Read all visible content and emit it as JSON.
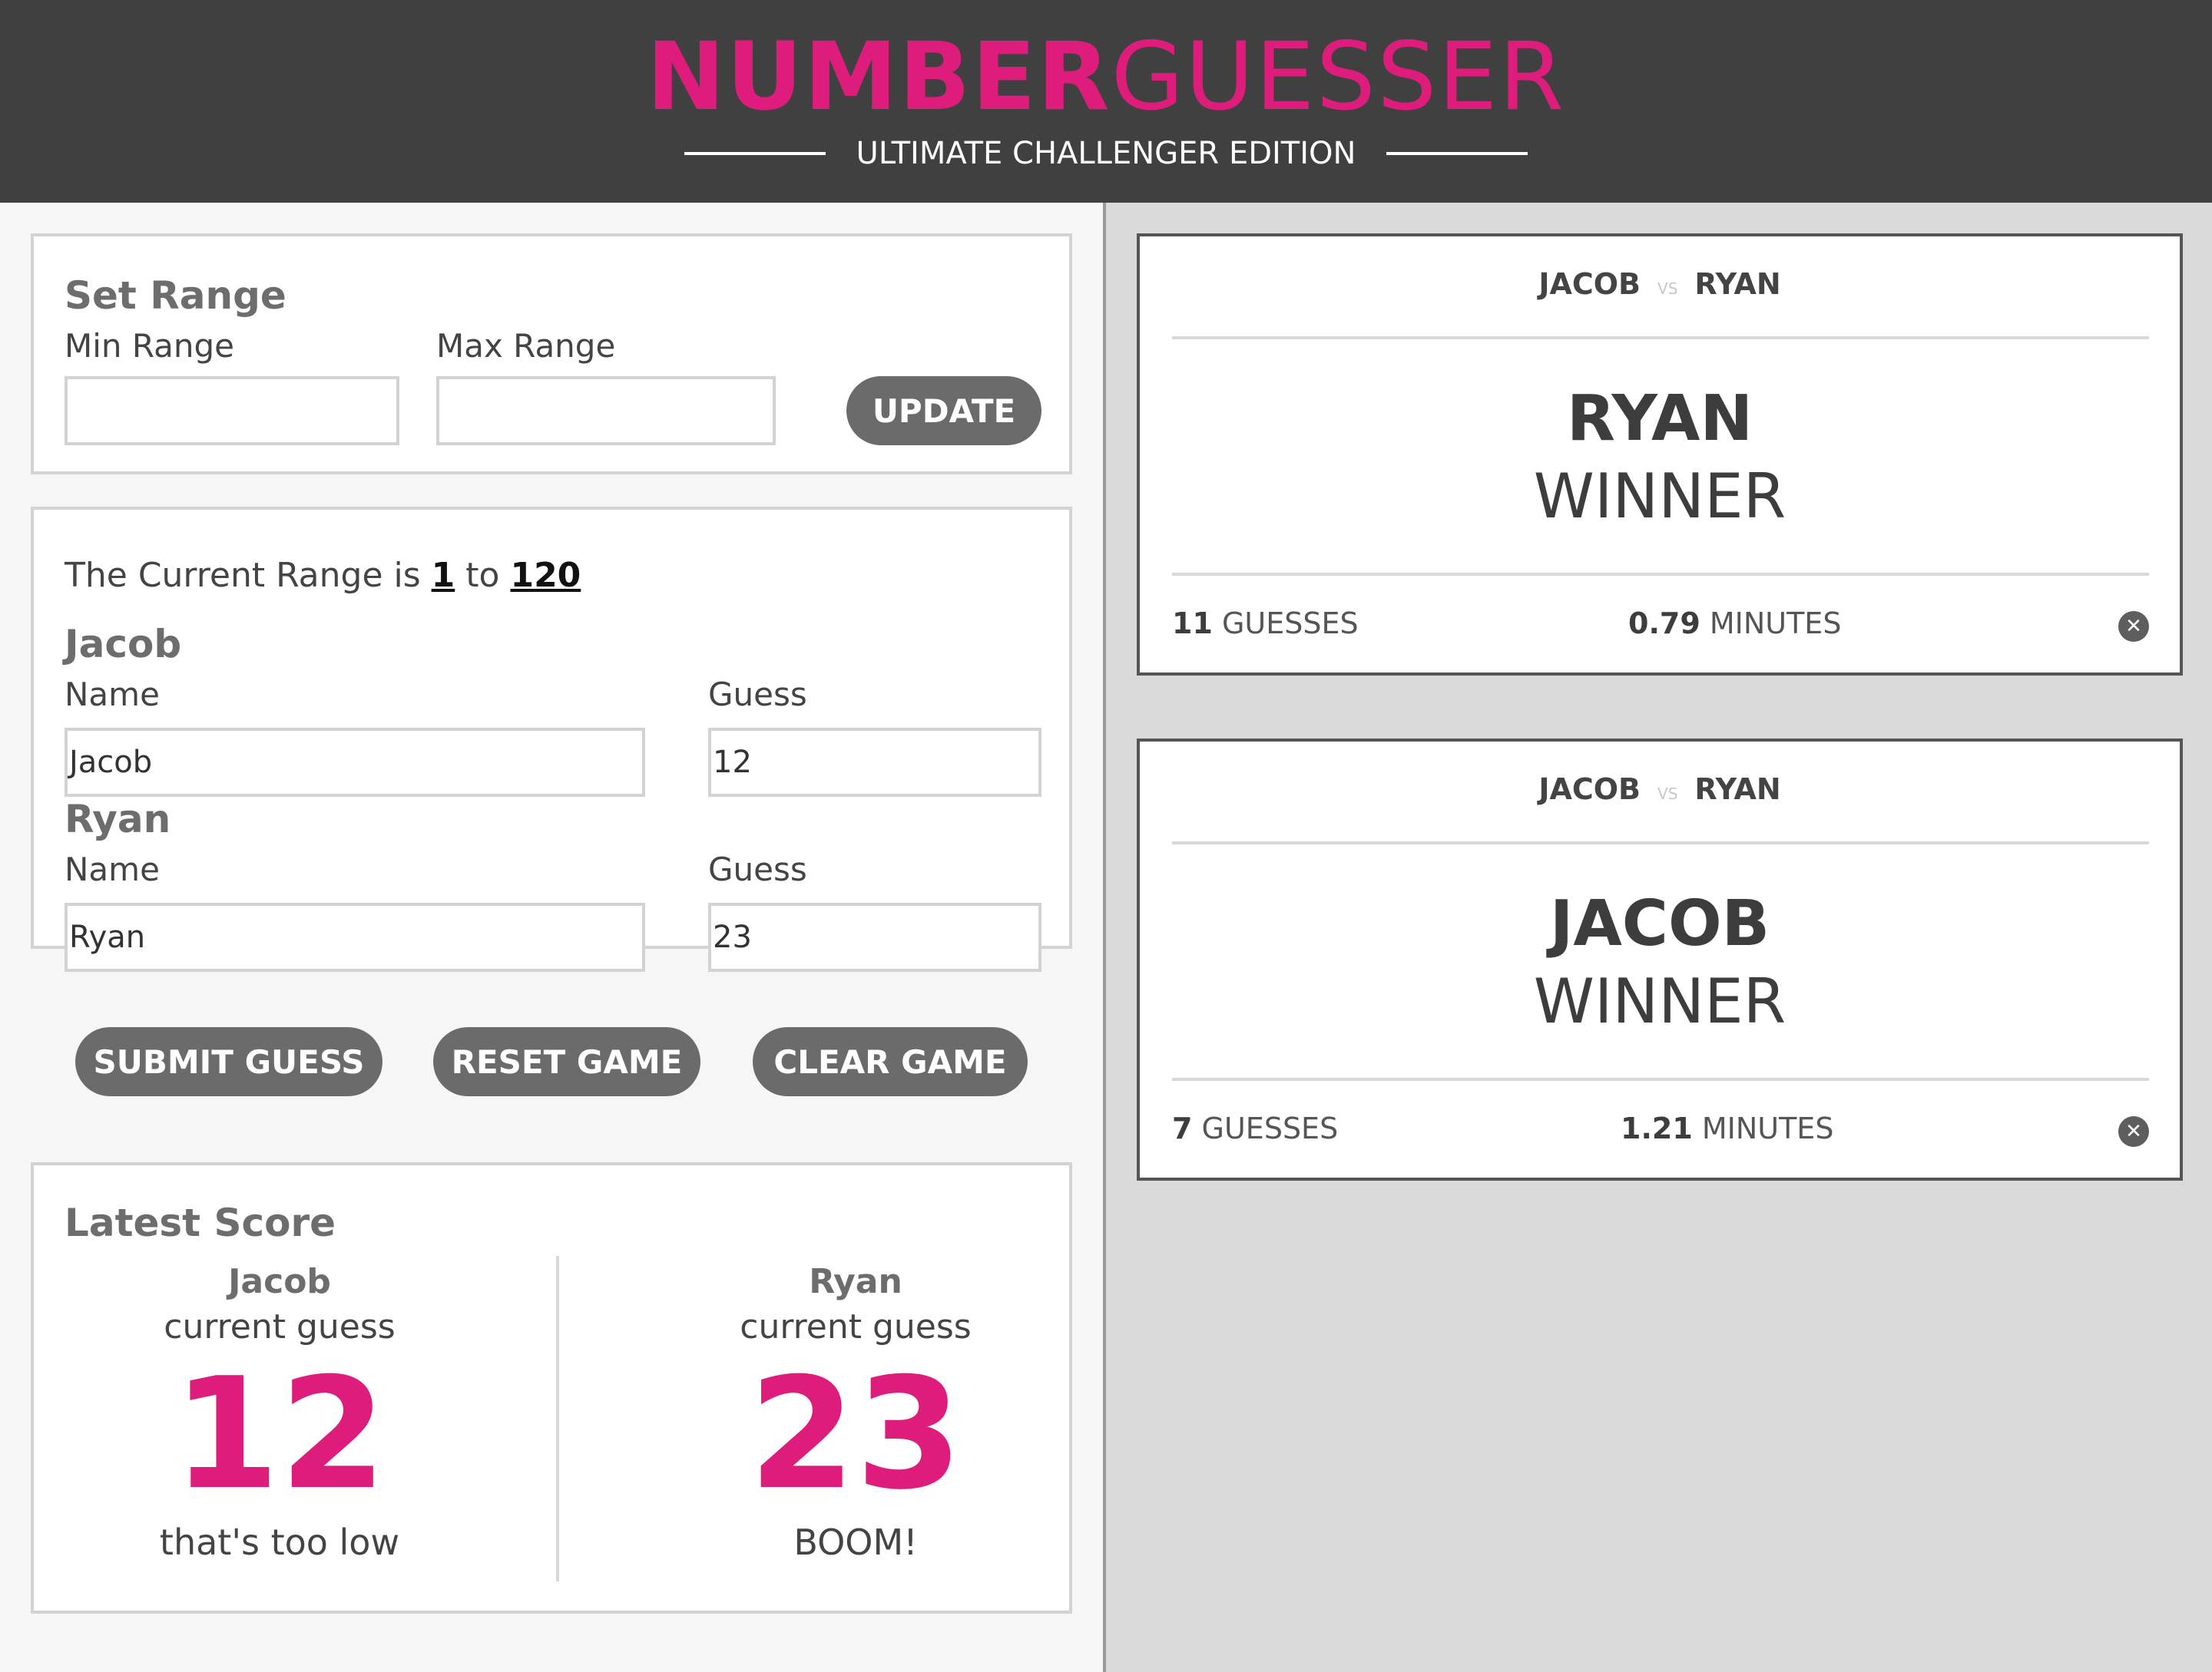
{
  "header": {
    "title_bold": "NUMBER",
    "title_light": "GUESSER",
    "subtitle": "ULTIMATE CHALLENGER EDITION"
  },
  "set_range": {
    "title": "Set Range",
    "min_label": "Min Range",
    "max_label": "Max Range",
    "min_value": "",
    "max_value": "",
    "update_label": "UPDATE"
  },
  "game": {
    "range_prefix": "The Current Range is",
    "range_min": "1",
    "range_to": "to",
    "range_max": "120",
    "player1": {
      "heading": "Jacob",
      "name_label": "Name",
      "guess_label": "Guess",
      "name_value": "Jacob",
      "guess_value": "12"
    },
    "player2": {
      "heading": "Ryan",
      "name_label": "Name",
      "guess_label": "Guess",
      "name_value": "Ryan",
      "guess_value": "23"
    },
    "submit_label": "SUBMIT GUESS",
    "reset_label": "RESET GAME",
    "clear_label": "CLEAR GAME"
  },
  "latest_score": {
    "title": "Latest Score",
    "left": {
      "name": "Jacob",
      "sub": "current guess",
      "value": "12",
      "message": "that's too low"
    },
    "right": {
      "name": "Ryan",
      "sub": "current guess",
      "value": "23",
      "message": "BOOM!"
    }
  },
  "results": [
    {
      "player1": "JACOB",
      "vs": "VS",
      "player2": "RYAN",
      "winner": "RYAN",
      "winner_label": "WINNER",
      "guesses_count": "11",
      "guesses_label": "GUESSES",
      "minutes_value": "0.79",
      "minutes_label": "MINUTES"
    },
    {
      "player1": "JACOB",
      "vs": "VS",
      "player2": "RYAN",
      "winner": "JACOB",
      "winner_label": "WINNER",
      "guesses_count": "7",
      "guesses_label": "GUESSES",
      "minutes_value": "1.21",
      "minutes_label": "MINUTES"
    }
  ],
  "colors": {
    "accent": "#de1c7c",
    "header_bg": "#404040",
    "button_bg": "#6b6b6b",
    "right_panel_bg": "#dadada"
  }
}
